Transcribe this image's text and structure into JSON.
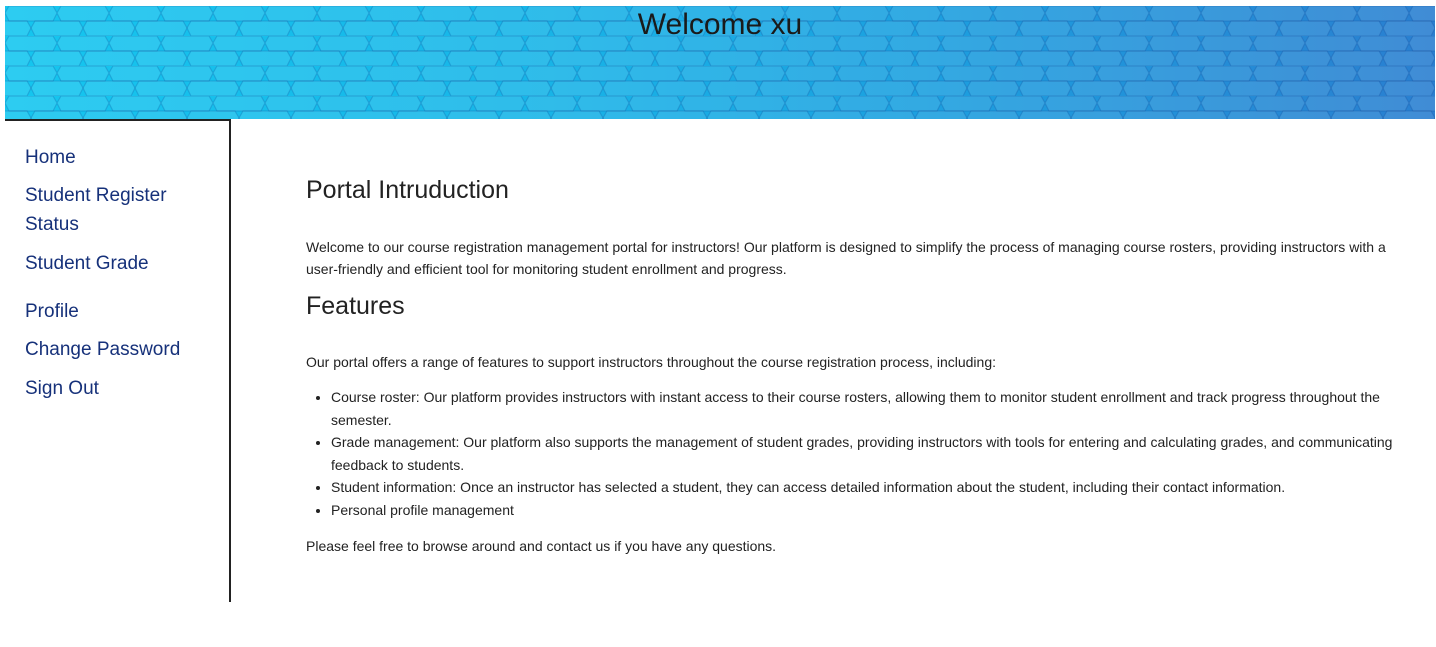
{
  "header": {
    "title": "Welcome xu"
  },
  "sidebar": {
    "items": [
      {
        "label": "Home"
      },
      {
        "label": "Student Register Status"
      },
      {
        "label": "Student Grade"
      },
      {
        "label": "Profile"
      },
      {
        "label": "Change Password"
      },
      {
        "label": "Sign Out"
      }
    ]
  },
  "main": {
    "intro_heading": "Portal Intruduction",
    "intro_text": "Welcome to our course registration management portal for instructors! Our platform is designed to simplify the process of managing course rosters, providing instructors with a user-friendly and efficient tool for monitoring student enrollment and progress.",
    "features_heading": "Features",
    "features_intro": "Our portal offers a range of features to support instructors throughout the course registration process, including:",
    "features": [
      "Course roster: Our platform provides instructors with instant access to their course rosters, allowing them to monitor student enrollment and track progress throughout the semester.",
      "Grade management: Our platform also supports the management of student grades, providing instructors with tools for entering and calculating grades, and communicating feedback to students.",
      "Student information: Once an instructor has selected a student, they can access detailed information about the student, including their contact information.",
      "Personal profile management"
    ],
    "closing_text": "Please feel free to browse around and contact us if you have any questions."
  },
  "colors": {
    "banner_start": "#15c6ef",
    "banner_end": "#2a7fd0",
    "nav_link": "#16317a"
  }
}
